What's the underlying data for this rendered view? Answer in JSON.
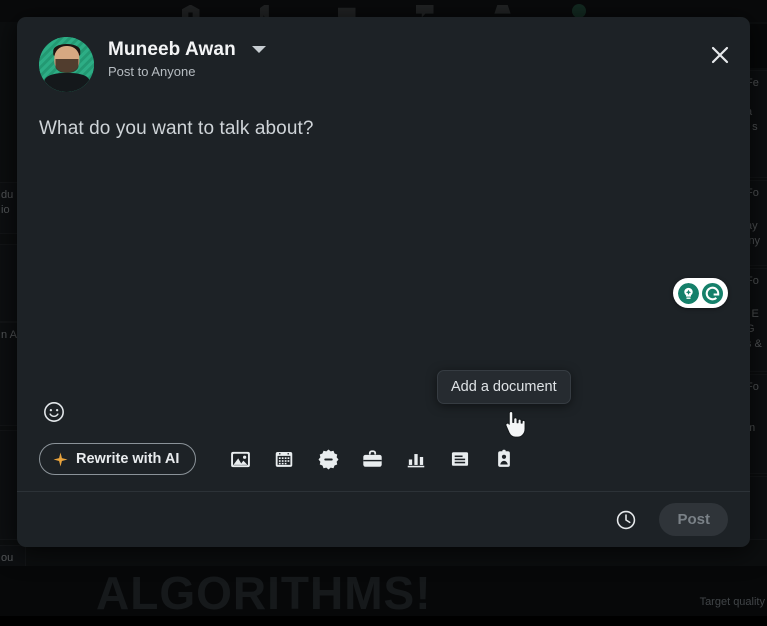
{
  "background": {
    "navbar_icons": [
      "home-icon",
      "network-icon",
      "jobs-icon",
      "messaging-icon",
      "notifications-icon",
      "profile-avatar-icon"
    ],
    "left_snippets": [
      "du",
      "io",
      "n A",
      "ou"
    ],
    "right_snippets": [
      "Fe",
      "a",
      "; s",
      "Fo",
      "ay",
      "iny",
      "Fo",
      "i E",
      "G",
      "s &",
      "Fo",
      "m"
    ],
    "hero_text": "ALGORITHMS!",
    "target_quality_label": "Target quality"
  },
  "modal": {
    "close_icon": "close-icon",
    "author": {
      "avatar": "user-avatar",
      "name": "Muneeb Awan",
      "audience": "Post to Anyone",
      "caret_icon": "chevron-down-icon"
    },
    "editor": {
      "placeholder": "What do you want to talk about?",
      "value": ""
    },
    "grammarly": {
      "idea_icon": "grammarly-idea-icon",
      "logo_icon": "grammarly-logo-icon",
      "brand_color": "#15806a"
    },
    "toolbar": {
      "emoji_button": "emoji-icon",
      "rewrite": {
        "label": "Rewrite with AI",
        "icon": "sparkle-icon",
        "icon_color": "#e8a33d"
      },
      "items": [
        {
          "name": "add-media-button",
          "icon": "image-icon"
        },
        {
          "name": "add-event-button",
          "icon": "calendar-icon"
        },
        {
          "name": "celebrate-button",
          "icon": "award-badge-icon"
        },
        {
          "name": "create-job-button",
          "icon": "briefcase-icon"
        },
        {
          "name": "create-poll-button",
          "icon": "bar-chart-icon"
        },
        {
          "name": "add-document-button",
          "icon": "document-icon"
        },
        {
          "name": "find-expert-button",
          "icon": "person-card-icon"
        }
      ],
      "tooltip": "Add a document",
      "cursor_icon": "pointing-hand-cursor"
    },
    "footer": {
      "schedule_icon": "clock-icon",
      "post_label": "Post",
      "post_enabled": false
    }
  },
  "colors": {
    "modal_bg": "#1d2226",
    "page_bg": "#1b1f23",
    "accent_orange": "#e8a33d",
    "grammarly_green": "#15806a",
    "post_disabled_bg": "#2f3439",
    "post_disabled_text": "#7a8187"
  }
}
